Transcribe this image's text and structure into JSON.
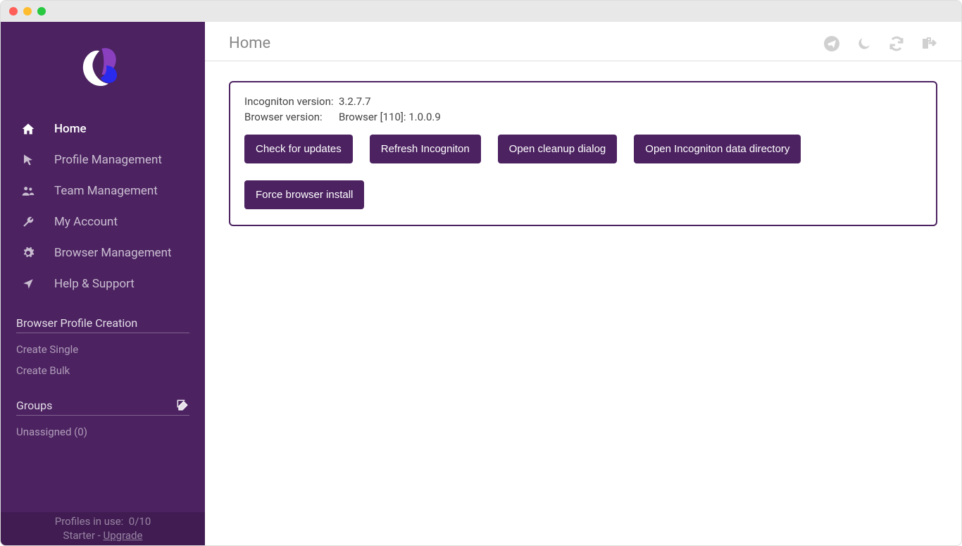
{
  "header": {
    "title": "Home"
  },
  "sidebar": {
    "nav": [
      {
        "label": "Home",
        "icon": "home-icon",
        "active": true
      },
      {
        "label": "Profile Management",
        "icon": "cursor-icon",
        "active": false
      },
      {
        "label": "Team Management",
        "icon": "users-icon",
        "active": false
      },
      {
        "label": "My Account",
        "icon": "wrench-icon",
        "active": false
      },
      {
        "label": "Browser Management",
        "icon": "gear-icon",
        "active": false
      },
      {
        "label": "Help & Support",
        "icon": "location-arrow-icon",
        "active": false
      }
    ],
    "profile_creation": {
      "title": "Browser Profile Creation",
      "links": [
        {
          "label": "Create Single"
        },
        {
          "label": "Create Bulk"
        }
      ]
    },
    "groups": {
      "title": "Groups",
      "items": [
        {
          "label": "Unassigned (0)"
        }
      ]
    },
    "footer": {
      "profiles_label": "Profiles in use:",
      "profiles_value": "0/10",
      "plan": "Starter",
      "separator": " - ",
      "upgrade": "Upgrade"
    }
  },
  "panel": {
    "info": [
      {
        "label": "Incogniton version:",
        "value": "3.2.7.7"
      },
      {
        "label": "Browser version:",
        "value": "Browser [110]: 1.0.0.9"
      }
    ],
    "buttons": [
      {
        "label": "Check for updates"
      },
      {
        "label": "Refresh Incogniton"
      },
      {
        "label": "Open cleanup dialog"
      },
      {
        "label": "Open Incogniton data directory"
      },
      {
        "label": "Force browser install"
      }
    ]
  }
}
